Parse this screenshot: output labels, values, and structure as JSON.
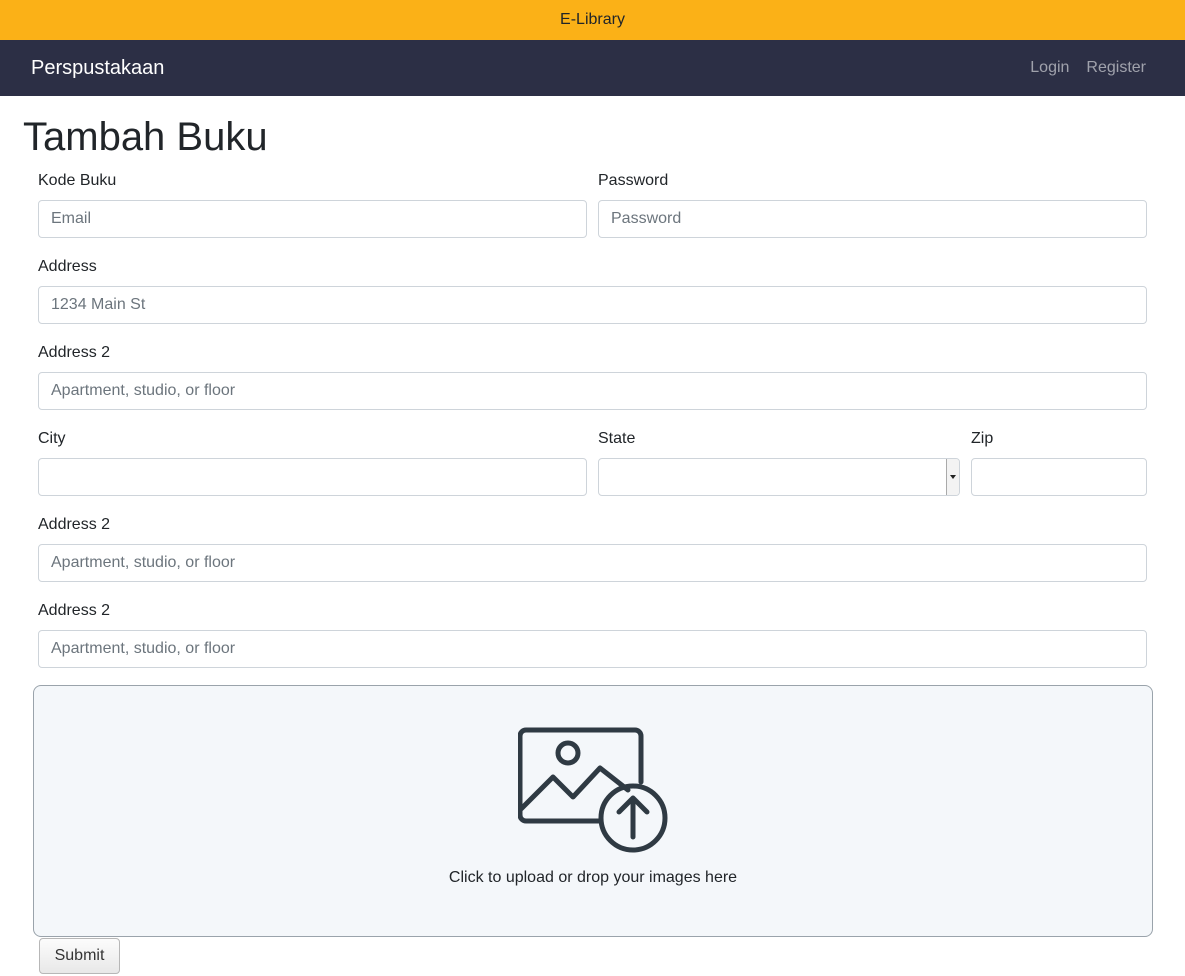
{
  "topbar": {
    "title": "E-Library"
  },
  "navbar": {
    "brand": "Perspustakaan",
    "links": {
      "login": "Login",
      "register": "Register"
    }
  },
  "page": {
    "title": "Tambah Buku"
  },
  "form": {
    "kode_buku": {
      "label": "Kode Buku",
      "placeholder": "Email",
      "value": ""
    },
    "password": {
      "label": "Password",
      "placeholder": "Password",
      "value": ""
    },
    "address": {
      "label": "Address",
      "placeholder": "1234 Main St",
      "value": ""
    },
    "address2_a": {
      "label": "Address 2",
      "placeholder": "Apartment, studio, or floor",
      "value": ""
    },
    "city": {
      "label": "City",
      "value": ""
    },
    "state": {
      "label": "State",
      "value": ""
    },
    "zip": {
      "label": "Zip",
      "value": ""
    },
    "address2_b": {
      "label": "Address 2",
      "placeholder": "Apartment, studio, or floor",
      "value": ""
    },
    "address2_c": {
      "label": "Address 2",
      "placeholder": "Apartment, studio, or floor",
      "value": ""
    },
    "upload": {
      "hint": "Click to upload or drop your images here",
      "icon": "image-upload-icon"
    },
    "submit_label": "Submit"
  },
  "colors": {
    "topbar": "#fbb117",
    "navbar": "#2c2f45",
    "dropzone_bg": "#f4f7fa",
    "icon": "#2f3a43"
  }
}
